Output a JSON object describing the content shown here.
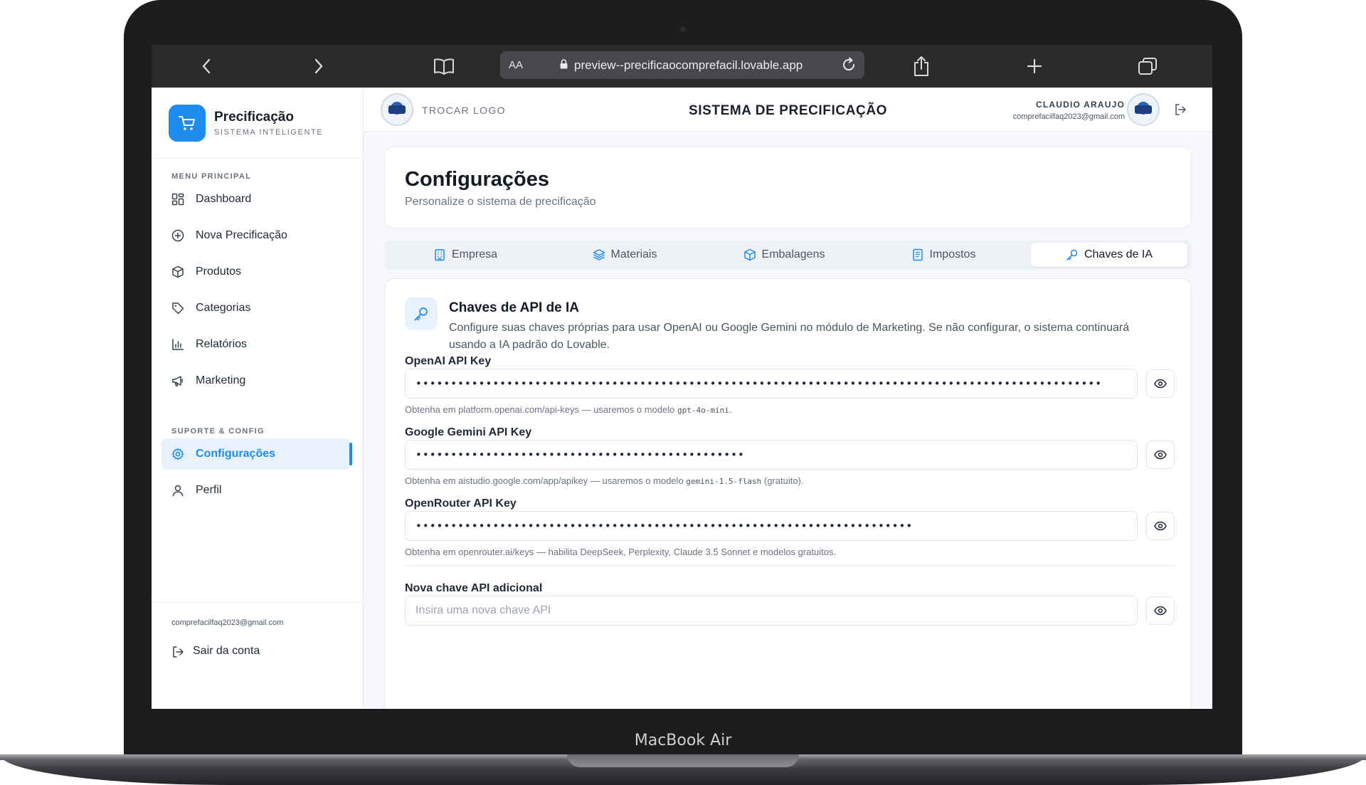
{
  "device": {
    "label": "MacBook Air"
  },
  "browser": {
    "text_size_label": "AA",
    "url": "preview--precificaocomprefacil.lovable.app"
  },
  "sidebar": {
    "brand_title": "Precificação",
    "brand_subtitle": "SISTEMA INTELIGENTE",
    "section_main": "MENU PRINCIPAL",
    "items": [
      {
        "label": "Dashboard",
        "icon": "dashboard-icon"
      },
      {
        "label": "Nova Precificação",
        "icon": "plus-circle-icon"
      },
      {
        "label": "Produtos",
        "icon": "box-icon"
      },
      {
        "label": "Categorias",
        "icon": "tag-icon"
      },
      {
        "label": "Relatórios",
        "icon": "bar-chart-icon"
      },
      {
        "label": "Marketing",
        "icon": "megaphone-icon"
      }
    ],
    "section_support": "SUPORTE & CONFIG",
    "support_items": [
      {
        "label": "Configurações",
        "icon": "gear-icon",
        "active": true
      },
      {
        "label": "Perfil",
        "icon": "user-icon"
      }
    ],
    "footer_email": "comprefacilfaq2023@gmail.com",
    "logout_label": "Sair da conta"
  },
  "header": {
    "change_logo_label": "TROCAR LOGO",
    "system_title": "SISTEMA DE PRECIFICAÇÃO",
    "user_name": "CLAUDIO ARAUJO",
    "user_email": "comprefacilfaq2023@gmail.com"
  },
  "page": {
    "title": "Configurações",
    "subtitle": "Personalize o sistema de precificação"
  },
  "tabs": [
    {
      "label": "Empresa",
      "icon": "building-icon"
    },
    {
      "label": "Materiais",
      "icon": "layers-icon"
    },
    {
      "label": "Embalagens",
      "icon": "package-icon"
    },
    {
      "label": "Impostos",
      "icon": "receipt-icon"
    },
    {
      "label": "Chaves de IA",
      "icon": "key-icon",
      "active": true
    }
  ],
  "keys": {
    "title": "Chaves de API de IA",
    "description": "Configure suas chaves próprias para usar OpenAI ou Google Gemini no módulo de Marketing. Se não configurar, o sistema continuará usando a IA padrão do Lovable.",
    "openai": {
      "label": "OpenAI API Key",
      "value": "••••••••••••••••••••••••••••••••••••••••••••••••••••••••••••••••••••••••••••••••••••••••••••••••••",
      "help_prefix": "Obtenha em platform.openai.com/api-keys — usaremos o modelo ",
      "help_code": "gpt-4o-mini",
      "help_suffix": "."
    },
    "gemini": {
      "label": "Google Gemini API Key",
      "value": "•••••••••••••••••••••••••••••••••••••••••••••••",
      "help_prefix": "Obtenha em aistudio.google.com/app/apikey — usaremos o modelo ",
      "help_code": "gemini-1.5-flash",
      "help_suffix": " (gratuito)."
    },
    "openrouter": {
      "label": "OpenRouter API Key",
      "value": "•••••••••••••••••••••••••••••••••••••••••••••••••••••••••••••••••••••••",
      "help": "Obtenha em openrouter.ai/keys — habilita DeepSeek, Perplexity, Claude 3.5 Sonnet e modelos gratuitos."
    },
    "additional": {
      "label": "Nova chave API adicional",
      "placeholder": "Insira uma nova chave API"
    }
  },
  "colors": {
    "accent": "#1d8bf0",
    "active_bg": "#e7f2fc"
  }
}
